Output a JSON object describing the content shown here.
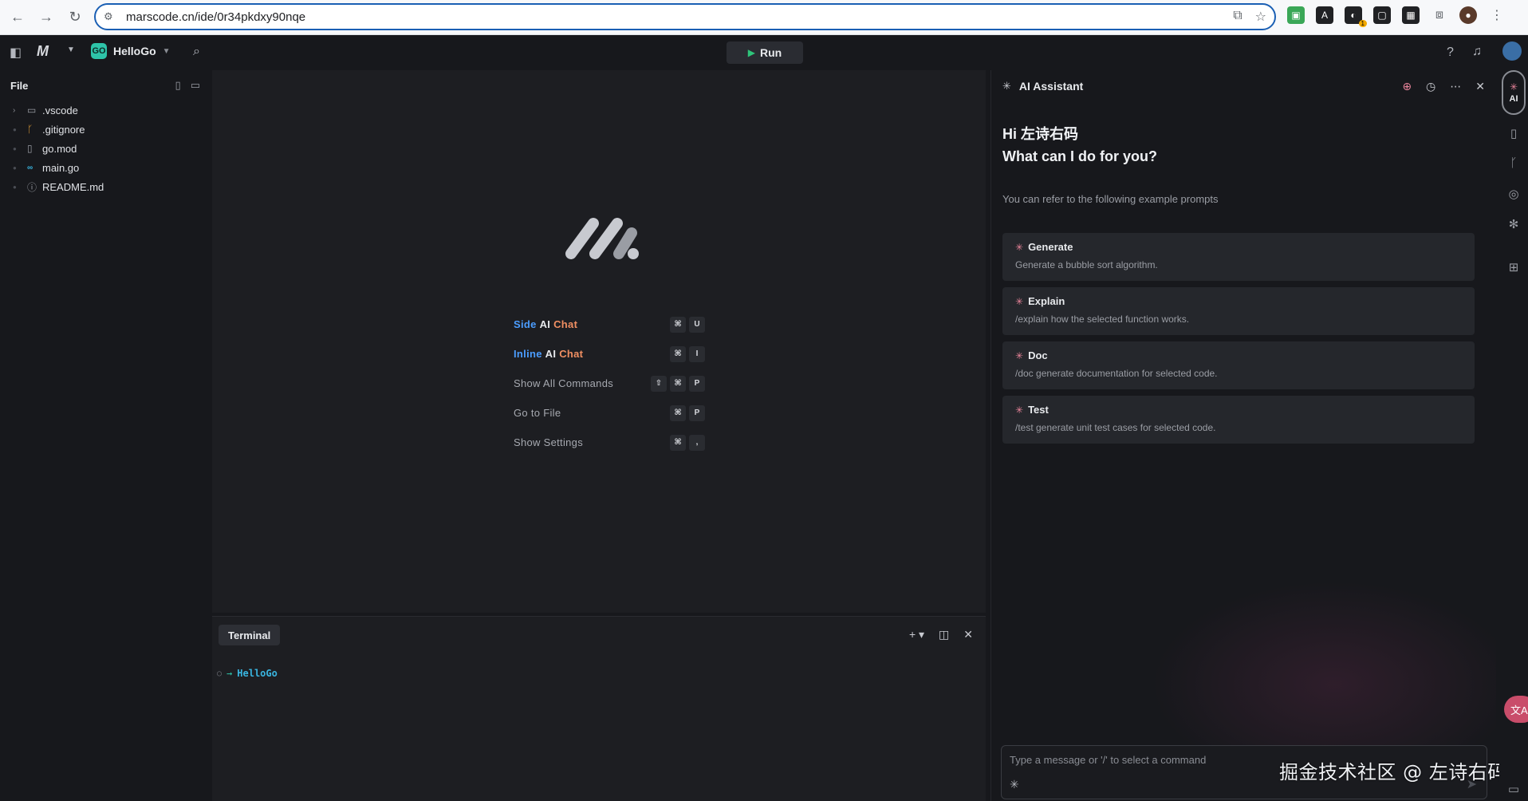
{
  "browser": {
    "url": "marscode.cn/ide/0r34pkdxy90nqe",
    "ext_badge": "1"
  },
  "app_bar": {
    "project_name": "HelloGo",
    "project_badge": "GO",
    "run_label": "Run"
  },
  "sidebar": {
    "title": "File",
    "items": [
      {
        "label": ".vscode",
        "kind": "folder"
      },
      {
        "label": ".gitignore",
        "kind": "git"
      },
      {
        "label": "go.mod",
        "kind": "file"
      },
      {
        "label": "main.go",
        "kind": "go"
      },
      {
        "label": "README.md",
        "kind": "info"
      }
    ]
  },
  "editor": {
    "shortcuts": [
      {
        "parts": [
          "Side",
          "AI",
          "Chat"
        ],
        "keys": [
          "⌘",
          "U"
        ]
      },
      {
        "parts": [
          "Inline",
          "AI",
          "Chat"
        ],
        "keys": [
          "⌘",
          "I"
        ]
      },
      {
        "label": "Show All Commands",
        "keys": [
          "⇧",
          "⌘",
          "P"
        ]
      },
      {
        "label": "Go to File",
        "keys": [
          "⌘",
          "P"
        ]
      },
      {
        "label": "Show Settings",
        "keys": [
          "⌘",
          ","
        ]
      }
    ]
  },
  "terminal": {
    "tab_label": "Terminal",
    "prompt_dir": "HelloGo"
  },
  "ai": {
    "title": "AI Assistant",
    "greeting_line1": "Hi 左诗右码",
    "greeting_line2": "What can I do for you?",
    "hint": "You can refer to the following example prompts",
    "prompts": [
      {
        "title": "Generate",
        "desc": "Generate a bubble sort algorithm."
      },
      {
        "title": "Explain",
        "desc": "/explain how the selected function works."
      },
      {
        "title": "Doc",
        "desc": "/doc generate documentation for selected code."
      },
      {
        "title": "Test",
        "desc": "/test generate unit test cases for selected code."
      }
    ],
    "input_placeholder": "Type a message or '/' to select a command",
    "activity_label": "AI"
  },
  "watermark": "掘金技术社区 @ 左诗右码",
  "colors": {
    "accent_blue": "#4b9dff",
    "accent_orange": "#f08f62",
    "go_green": "#2ec4a9",
    "run_green": "#2ec47a"
  }
}
